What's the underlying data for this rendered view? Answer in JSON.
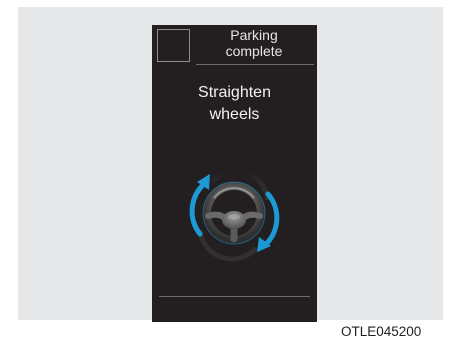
{
  "header": {
    "status_text": "Parking\ncomplete",
    "status_icon": "blank-indicator-icon"
  },
  "main": {
    "message": "Straighten\nwheels",
    "graphic_icon": "steering-wheel-icon",
    "rotation_arrows": "rotate-arrows-icon"
  },
  "figure": {
    "caption": "OTLE045200"
  },
  "colors": {
    "screen_background": "#231f20",
    "panel_background": "#e6e7e8",
    "arrow_blue": "#1c9ad6"
  }
}
